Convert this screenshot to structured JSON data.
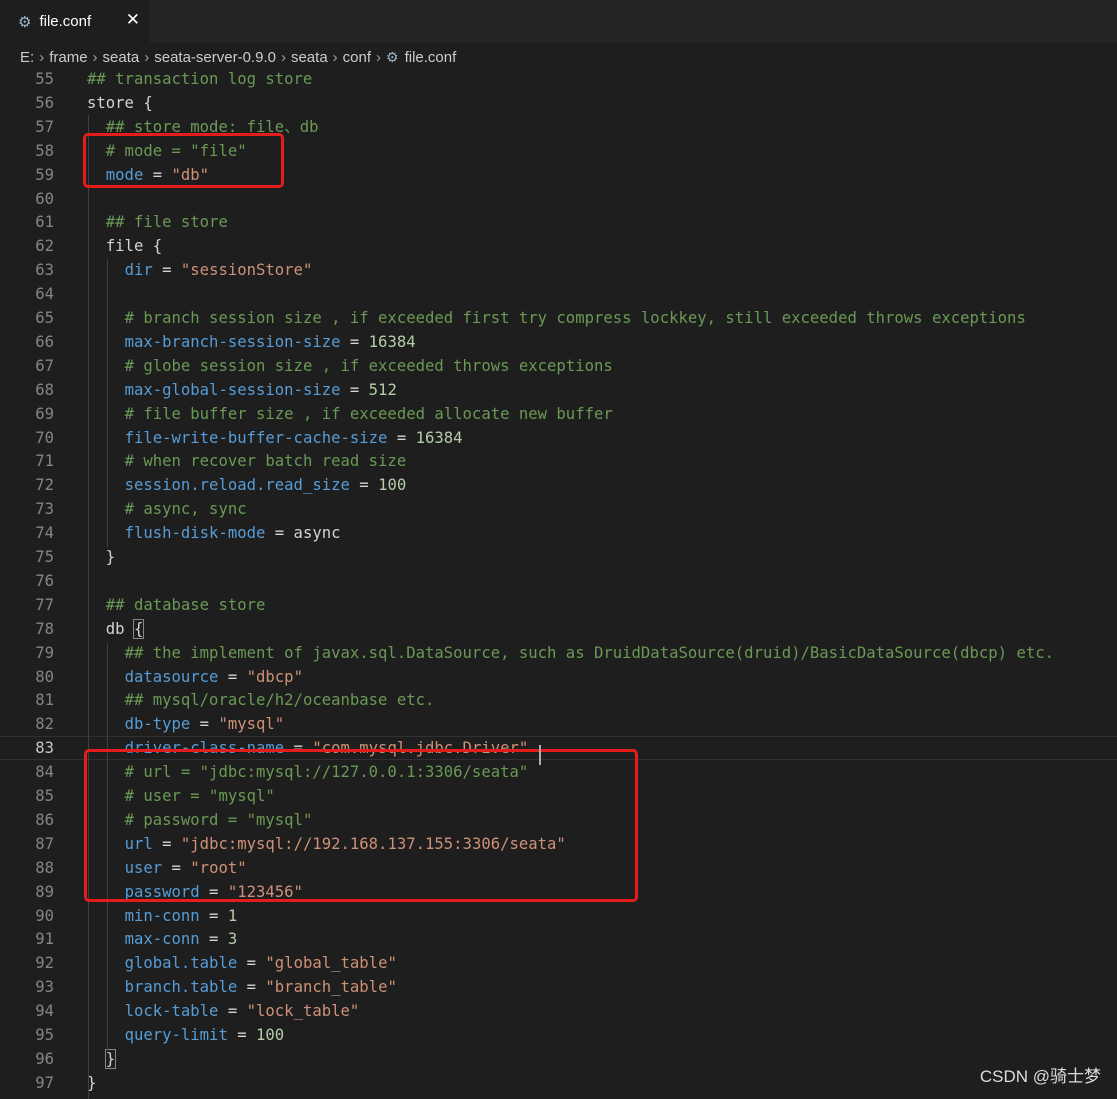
{
  "tab": {
    "title": "file.conf",
    "icon": "gear-icon",
    "close_glyph": "✕"
  },
  "breadcrumb": [
    "E:",
    "frame",
    "seata",
    "seata-server-0.9.0",
    "seata",
    "conf",
    "file.conf"
  ],
  "editor": {
    "active_line": 83,
    "lines": [
      {
        "n": "55",
        "t": [
          [
            "cm",
            "## transaction log store"
          ]
        ]
      },
      {
        "n": "56",
        "t": [
          [
            "p",
            "store {"
          ]
        ]
      },
      {
        "n": "57",
        "t": [
          [
            "p",
            "  "
          ],
          [
            "cm",
            "## store mode: file、db"
          ]
        ]
      },
      {
        "n": "58",
        "t": [
          [
            "p",
            "  "
          ],
          [
            "cm",
            "# mode = \"file\""
          ]
        ]
      },
      {
        "n": "59",
        "t": [
          [
            "p",
            "  "
          ],
          [
            "k",
            "mode"
          ],
          [
            "p",
            " = "
          ],
          [
            "s",
            "\"db\""
          ]
        ]
      },
      {
        "n": "60",
        "t": []
      },
      {
        "n": "61",
        "t": [
          [
            "p",
            "  "
          ],
          [
            "cm",
            "## file store"
          ]
        ]
      },
      {
        "n": "62",
        "t": [
          [
            "p",
            "  file {"
          ]
        ]
      },
      {
        "n": "63",
        "t": [
          [
            "p",
            "    "
          ],
          [
            "k",
            "dir"
          ],
          [
            "p",
            " = "
          ],
          [
            "s",
            "\"sessionStore\""
          ]
        ]
      },
      {
        "n": "64",
        "t": []
      },
      {
        "n": "65",
        "t": [
          [
            "p",
            "    "
          ],
          [
            "cm",
            "# branch session size , if exceeded first try compress lockkey, still exceeded throws exceptions"
          ]
        ]
      },
      {
        "n": "66",
        "t": [
          [
            "p",
            "    "
          ],
          [
            "k",
            "max-branch-session-size"
          ],
          [
            "p",
            " = "
          ],
          [
            "n",
            "16384"
          ]
        ]
      },
      {
        "n": "67",
        "t": [
          [
            "p",
            "    "
          ],
          [
            "cm",
            "# globe session size , if exceeded throws exceptions"
          ]
        ]
      },
      {
        "n": "68",
        "t": [
          [
            "p",
            "    "
          ],
          [
            "k",
            "max-global-session-size"
          ],
          [
            "p",
            " = "
          ],
          [
            "n",
            "512"
          ]
        ]
      },
      {
        "n": "69",
        "t": [
          [
            "p",
            "    "
          ],
          [
            "cm",
            "# file buffer size , if exceeded allocate new buffer"
          ]
        ]
      },
      {
        "n": "70",
        "t": [
          [
            "p",
            "    "
          ],
          [
            "k",
            "file-write-buffer-cache-size"
          ],
          [
            "p",
            " = "
          ],
          [
            "n",
            "16384"
          ]
        ]
      },
      {
        "n": "71",
        "t": [
          [
            "p",
            "    "
          ],
          [
            "cm",
            "# when recover batch read size"
          ]
        ]
      },
      {
        "n": "72",
        "t": [
          [
            "p",
            "    "
          ],
          [
            "k",
            "session.reload.read_size"
          ],
          [
            "p",
            " = "
          ],
          [
            "n",
            "100"
          ]
        ]
      },
      {
        "n": "73",
        "t": [
          [
            "p",
            "    "
          ],
          [
            "cm",
            "# async, sync"
          ]
        ]
      },
      {
        "n": "74",
        "t": [
          [
            "p",
            "    "
          ],
          [
            "k",
            "flush-disk-mode"
          ],
          [
            "p",
            " = async"
          ]
        ]
      },
      {
        "n": "75",
        "t": [
          [
            "p",
            "  }"
          ]
        ]
      },
      {
        "n": "76",
        "t": []
      },
      {
        "n": "77",
        "t": [
          [
            "p",
            "  "
          ],
          [
            "cm",
            "## database store"
          ]
        ]
      },
      {
        "n": "78",
        "t": [
          [
            "p",
            "  db "
          ],
          [
            "pb",
            "{"
          ]
        ]
      },
      {
        "n": "79",
        "t": [
          [
            "p",
            "    "
          ],
          [
            "cm",
            "## the implement of javax.sql.DataSource, such as DruidDataSource(druid)/BasicDataSource(dbcp) etc."
          ]
        ]
      },
      {
        "n": "80",
        "t": [
          [
            "p",
            "    "
          ],
          [
            "k",
            "datasource"
          ],
          [
            "p",
            " = "
          ],
          [
            "s",
            "\"dbcp\""
          ]
        ]
      },
      {
        "n": "81",
        "t": [
          [
            "p",
            "    "
          ],
          [
            "cm",
            "## mysql/oracle/h2/oceanbase etc."
          ]
        ]
      },
      {
        "n": "82",
        "t": [
          [
            "p",
            "    "
          ],
          [
            "k",
            "db-type"
          ],
          [
            "p",
            " = "
          ],
          [
            "s",
            "\"mysql\""
          ]
        ]
      },
      {
        "n": "83",
        "t": [
          [
            "p",
            "    "
          ],
          [
            "k",
            "driver-class-name"
          ],
          [
            "p",
            " = "
          ],
          [
            "s",
            "\"com.mysql.jdbc.Driver\""
          ]
        ]
      },
      {
        "n": "84",
        "t": [
          [
            "p",
            "    "
          ],
          [
            "cm",
            "# url = \"jdbc:mysql://127.0.0.1:3306/seata\""
          ]
        ]
      },
      {
        "n": "85",
        "t": [
          [
            "p",
            "    "
          ],
          [
            "cm",
            "# user = \"mysql\""
          ]
        ]
      },
      {
        "n": "86",
        "t": [
          [
            "p",
            "    "
          ],
          [
            "cm",
            "# password = \"mysql\""
          ]
        ]
      },
      {
        "n": "87",
        "t": [
          [
            "p",
            "    "
          ],
          [
            "k",
            "url"
          ],
          [
            "p",
            " = "
          ],
          [
            "s",
            "\"jdbc:mysql://192.168.137.155:3306/seata\""
          ]
        ]
      },
      {
        "n": "88",
        "t": [
          [
            "p",
            "    "
          ],
          [
            "k",
            "user"
          ],
          [
            "p",
            " = "
          ],
          [
            "s",
            "\"root\""
          ]
        ]
      },
      {
        "n": "89",
        "t": [
          [
            "p",
            "    "
          ],
          [
            "k",
            "password"
          ],
          [
            "p",
            " = "
          ],
          [
            "s",
            "\"123456\""
          ]
        ]
      },
      {
        "n": "90",
        "t": [
          [
            "p",
            "    "
          ],
          [
            "k",
            "min-conn"
          ],
          [
            "p",
            " = "
          ],
          [
            "n",
            "1"
          ]
        ]
      },
      {
        "n": "91",
        "t": [
          [
            "p",
            "    "
          ],
          [
            "k",
            "max-conn"
          ],
          [
            "p",
            " = "
          ],
          [
            "n",
            "3"
          ]
        ]
      },
      {
        "n": "92",
        "t": [
          [
            "p",
            "    "
          ],
          [
            "k",
            "global.table"
          ],
          [
            "p",
            " = "
          ],
          [
            "s",
            "\"global_table\""
          ]
        ]
      },
      {
        "n": "93",
        "t": [
          [
            "p",
            "    "
          ],
          [
            "k",
            "branch.table"
          ],
          [
            "p",
            " = "
          ],
          [
            "s",
            "\"branch_table\""
          ]
        ]
      },
      {
        "n": "94",
        "t": [
          [
            "p",
            "    "
          ],
          [
            "k",
            "lock-table"
          ],
          [
            "p",
            " = "
          ],
          [
            "s",
            "\"lock_table\""
          ]
        ]
      },
      {
        "n": "95",
        "t": [
          [
            "p",
            "    "
          ],
          [
            "k",
            "query-limit"
          ],
          [
            "p",
            " = "
          ],
          [
            "n",
            "100"
          ]
        ]
      },
      {
        "n": "96",
        "t": [
          [
            "p",
            "  "
          ],
          [
            "pb",
            "}"
          ]
        ]
      },
      {
        "n": "97",
        "t": [
          [
            "p",
            "}"
          ]
        ]
      }
    ]
  },
  "annotations": [
    "red-box-mode-setting",
    "red-box-db-connection"
  ],
  "watermark": "CSDN @骑士梦",
  "colors": {
    "background": "#1e1e1e",
    "comment": "#6a9955",
    "key": "#569cd6",
    "string": "#ce9178",
    "number": "#b5cea8",
    "highlight_box": "#e51c1c"
  }
}
